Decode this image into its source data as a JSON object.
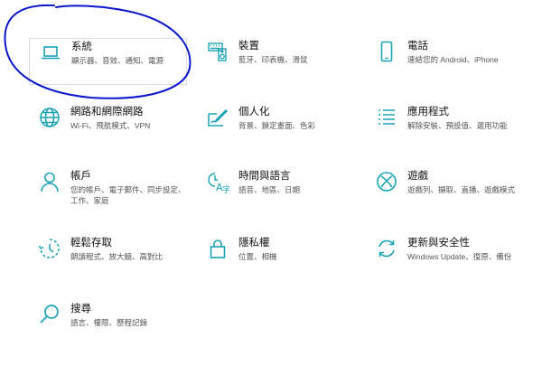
{
  "accent_color": "#1aa3b3",
  "annotation_color": "#0b18c9",
  "tiles": [
    {
      "name": "system",
      "title": "系統",
      "desc": "顯示器、音效、通知、電源",
      "icon": "laptop-icon"
    },
    {
      "name": "devices",
      "title": "裝置",
      "desc": "藍牙、印表機、滑鼠",
      "icon": "keyboard-speaker-icon"
    },
    {
      "name": "phone",
      "title": "電話",
      "desc": "連結您的 Android、iPhone",
      "icon": "phone-icon"
    },
    {
      "name": "network",
      "title": "網路和網際網路",
      "desc": "Wi-Fi、飛航模式、VPN",
      "icon": "globe-icon"
    },
    {
      "name": "personalization",
      "title": "個人化",
      "desc": "背景、鎖定畫面、色彩",
      "icon": "brush-icon"
    },
    {
      "name": "apps",
      "title": "應用程式",
      "desc": "解除安裝、預設值、選用功能",
      "icon": "apps-list-icon"
    },
    {
      "name": "accounts",
      "title": "帳戶",
      "desc": "您的帳戶、電子郵件、同步設定、工作、家庭",
      "icon": "person-icon"
    },
    {
      "name": "time-language",
      "title": "時間與語言",
      "desc": "語音、地區、日期",
      "icon": "time-language-icon"
    },
    {
      "name": "gaming",
      "title": "遊戲",
      "desc": "遊戲列、擷取、直播、遊戲模式",
      "icon": "xbox-icon"
    },
    {
      "name": "ease-of-access",
      "title": "輕鬆存取",
      "desc": "朗讀程式、放大鏡、高對比",
      "icon": "ease-of-access-icon"
    },
    {
      "name": "privacy",
      "title": "隱私權",
      "desc": "位置、相機",
      "icon": "lock-icon"
    },
    {
      "name": "update-security",
      "title": "更新與安全性",
      "desc": "Windows Update、復原、備份",
      "icon": "refresh-icon"
    },
    {
      "name": "search",
      "title": "搜尋",
      "desc": "語言、權限、歷程記錄",
      "icon": "search-icon"
    }
  ]
}
